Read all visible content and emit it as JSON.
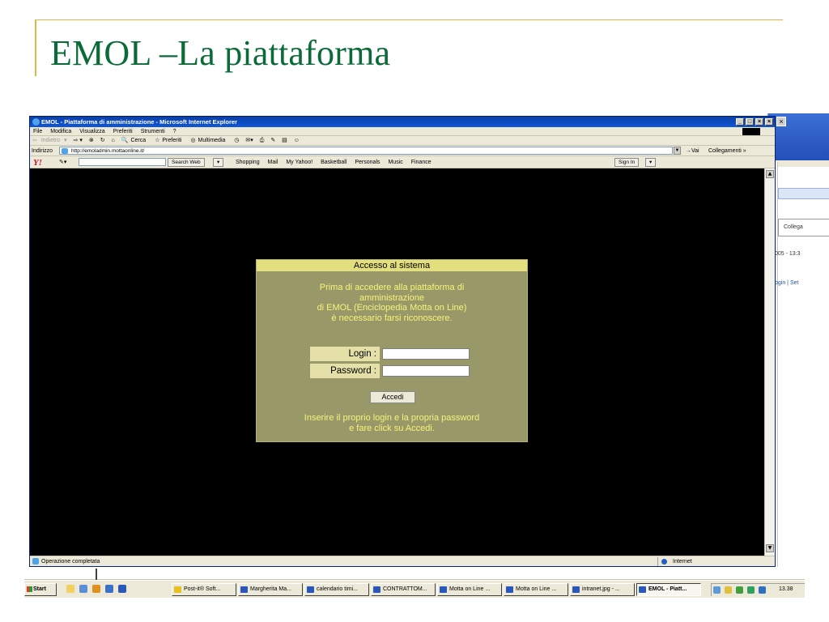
{
  "slide": {
    "title": "EMOL –La piattaforma"
  },
  "browser": {
    "window_title": "EMOL - Piattaforma di amministrazione - Microsoft Internet Explorer",
    "menu": [
      "File",
      "Modifica",
      "Visualizza",
      "Preferiti",
      "Strumenti",
      "?"
    ],
    "toolbar": {
      "back": "Indietro",
      "search": "Cerca",
      "favorites": "Preferiti",
      "multimedia": "Multimedia"
    },
    "address_label": "Indirizzo",
    "address_value": "http://emoladmin.mottaonline.it/",
    "go_label": "Vai",
    "links_label": "Collegamenti",
    "yahoo": {
      "logo": "Y!",
      "search_button": "Search Web",
      "links": [
        "Shopping",
        "Mail",
        "My Yahoo!",
        "Basketball",
        "Personals",
        "Music",
        "Finance"
      ],
      "sign_in": "Sign In"
    },
    "status_text": "Operazione completata",
    "zone": "Internet"
  },
  "login": {
    "header": "Accesso al sistema",
    "intro_lines": [
      "Prima di accedere alla piattaforma di",
      "amministrazione",
      "di EMOL (Enciclopedia Motta on Line)",
      "è necessario farsi riconoscere."
    ],
    "login_label": "Login :",
    "password_label": "Password :",
    "login_value": "",
    "password_value": "",
    "submit_label": "Accedi",
    "footer_lines": [
      "Inserire il proprio login e la propria password",
      "e fare click su Accedi."
    ]
  },
  "background_window": {
    "links_label": "Collega",
    "date_text": "005 - 13:3",
    "login_text": "ogin | Set"
  },
  "taskbar": {
    "start": "Start",
    "tasks": [
      "Post-it® Soft...",
      "Margherita Ma...",
      "calendario timi...",
      "CONTRATTOM...",
      "Motta on Line ...",
      "Motta on Line ...",
      "intranet.jpg - ...",
      "EMOL - Piatt..."
    ],
    "active_task": "EMOL - Piatt...",
    "clock": "13.38"
  }
}
